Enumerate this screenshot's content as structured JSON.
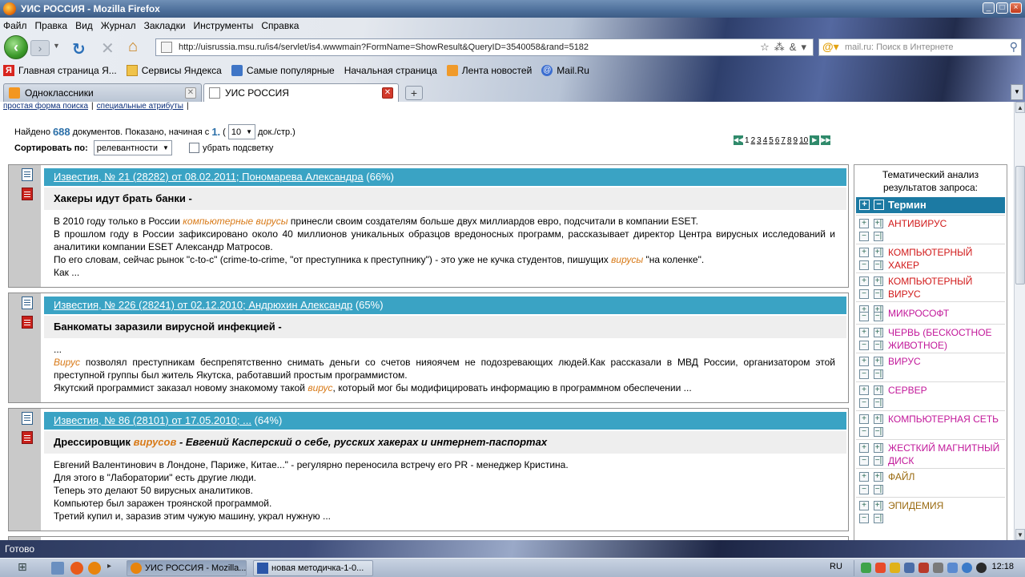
{
  "window": {
    "title": "УИС РОССИЯ - Mozilla Firefox",
    "buttons": [
      "_",
      "□",
      "×"
    ]
  },
  "menu": [
    "Файл",
    "Правка",
    "Вид",
    "Журнал",
    "Закладки",
    "Инструменты",
    "Справка"
  ],
  "nav": {
    "url": "http://uisrussia.msu.ru/is4/servlet/is4.wwwmain?FormName=ShowResult&QueryID=3540058&rand=5182",
    "search_placeholder": "mail.ru: Поиск в Интернете"
  },
  "bookmarks": [
    {
      "label": "Главная страница Я...",
      "icon": "yandex-icon"
    },
    {
      "label": "Сервисы Яндекса",
      "icon": "folder-icon"
    },
    {
      "label": "Самые популярные",
      "icon": "popular-icon"
    },
    {
      "label": "Начальная страница",
      "icon": "page-icon"
    },
    {
      "label": "Лента новостей",
      "icon": "rss-icon"
    },
    {
      "label": "Mail.Ru",
      "icon": "mailru-icon"
    }
  ],
  "tabs": [
    {
      "label": "Одноклассники",
      "active": false
    },
    {
      "label": "УИС РОССИЯ",
      "active": true
    }
  ],
  "page": {
    "top_links": [
      "простая форма поиска",
      "специальные атрибуты"
    ],
    "found_prefix": "Найдено",
    "found_count": "688",
    "found_mid": "документов. Показано, начиная с",
    "start_from": "1.",
    "per_page": "10",
    "per_page_suffix": "док./стр.)",
    "sort_label": "Сортировать по:",
    "sort_value": "релевантности",
    "highlight_label": "убрать подсветку",
    "pages": [
      "1",
      "2",
      "3",
      "4",
      "5",
      "6",
      "7",
      "8",
      "9",
      "10"
    ]
  },
  "results": [
    {
      "source": "Известия, № 21 (28282) от 08.02.2011; Пономарева Александра",
      "relevance": "(66%)",
      "title": "Хакеры идут брать банки -",
      "lines": [
        [
          "В 2010 году только в России ",
          {
            "hl": "компьютерные вирусы"
          },
          " принесли своим создателям больше двух миллиардов евро, подсчитали в компании ESET."
        ],
        [
          "В прошлом году в России зафиксировано около 40 миллионов уникальных образцов вредоносных программ, рассказывает директор Центра вирусных исследований и аналитики компании ESET Александр Матросов."
        ],
        [
          "По его словам, сейчас рынок \"с-to-с\" (crime-to-crime, \"от преступника к преступнику\") - это уже не кучка студентов, пишущих ",
          {
            "hl": "вирусы"
          },
          " \"на коленке\"."
        ],
        [
          "Как ..."
        ]
      ]
    },
    {
      "source": "Известия, № 226 (28241) от 02.12.2010; Андрюхин Александр",
      "relevance": "(65%)",
      "title": "Банкоматы заразили вирусной инфекцией -",
      "lines": [
        [
          "..."
        ],
        [
          {
            "hl": "Вирус"
          },
          " позволял преступникам беспрепятственно снимать деньги со счетов нияоячем не подозревающих людей.Как рассказали в МВД России, организатором этой преступной группы был житель Якутска, работавший простым программистом."
        ],
        [
          "Якутский программист заказал новому знакомому такой ",
          {
            "hl": "вирус"
          },
          ", который мог бы модифицировать информацию в программном обеспечении ..."
        ]
      ]
    },
    {
      "source": "Известия, № 86 (28101) от 17.05.2010; ...",
      "relevance": "(64%)",
      "title_parts": [
        "Дрессировщик ",
        {
          "hl": "вирусов"
        },
        {
          "it": " - Евгений Касперский о себе, русских хакерах и интернет-паспортах"
        }
      ],
      "lines": [
        [
          "Евгений Валентинович в Лондоне, Париже, Китае...\" - регулярно переносила встречу его PR - менеджер Кристина."
        ],
        [
          "Для этого в \"Лаборатории\" есть другие люди."
        ],
        [
          "Теперь это делают 50 вирусных аналитиков."
        ],
        [
          "Компьютер был заражен троянской программой."
        ],
        [
          "Третий купил и, заразив этим чужую машину, украл нужную ..."
        ]
      ]
    }
  ],
  "sidebar": {
    "title": "Тематический анализ результатов запроса:",
    "head": "Термин",
    "terms": [
      {
        "label": "АНТИВИРУС",
        "color": "#d11a1a"
      },
      {
        "label": "КОМПЬЮТЕРНЫЙ ХАКЕР",
        "color": "#d11a1a"
      },
      {
        "label": "КОМПЬЮТЕРНЫЙ ВИРУС",
        "color": "#d11a1a"
      },
      {
        "label": "МИКРОСОФТ",
        "color": "#c2189a"
      },
      {
        "label": "ЧЕРВЬ (БЕСКОСТНОЕ ЖИВОТНОЕ)",
        "color": "#c2189a"
      },
      {
        "label": "ВИРУС",
        "color": "#c2189a"
      },
      {
        "label": "СЕРВЕР",
        "color": "#c2189a"
      },
      {
        "label": "КОМПЬЮТЕРНАЯ СЕТЬ",
        "color": "#c2189a"
      },
      {
        "label": "ЖЕСТКИЙ МАГНИТНЫЙ ДИСК",
        "color": "#c2189a"
      },
      {
        "label": "ФАЙЛ",
        "color": "#9a6a10"
      },
      {
        "label": "ЭПИДЕМИЯ",
        "color": "#9a6a10"
      }
    ]
  },
  "status": "Готово",
  "taskbar": {
    "buttons": [
      "УИС РОССИЯ - Mozilla...",
      "новая методичка-1-0..."
    ],
    "lang": "RU",
    "clock": "12:18"
  }
}
